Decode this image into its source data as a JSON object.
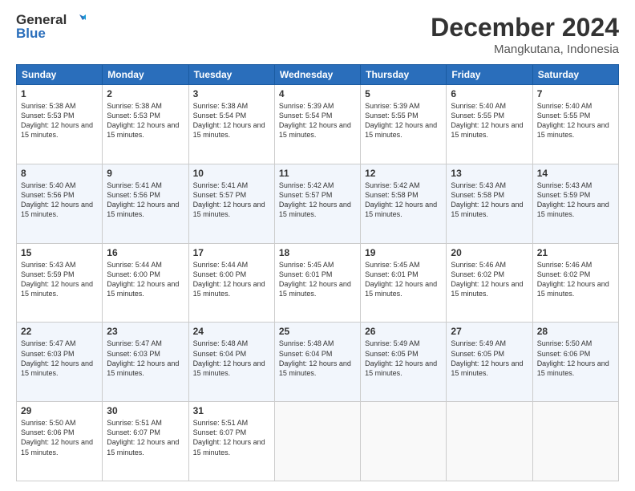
{
  "logo": {
    "line1": "General",
    "line2": "Blue"
  },
  "title": "December 2024",
  "subtitle": "Mangkutana, Indonesia",
  "days_of_week": [
    "Sunday",
    "Monday",
    "Tuesday",
    "Wednesday",
    "Thursday",
    "Friday",
    "Saturday"
  ],
  "weeks": [
    [
      {
        "day": "1",
        "info": "Sunrise: 5:38 AM\nSunset: 5:53 PM\nDaylight: 12 hours and 15 minutes."
      },
      {
        "day": "2",
        "info": "Sunrise: 5:38 AM\nSunset: 5:53 PM\nDaylight: 12 hours and 15 minutes."
      },
      {
        "day": "3",
        "info": "Sunrise: 5:38 AM\nSunset: 5:54 PM\nDaylight: 12 hours and 15 minutes."
      },
      {
        "day": "4",
        "info": "Sunrise: 5:39 AM\nSunset: 5:54 PM\nDaylight: 12 hours and 15 minutes."
      },
      {
        "day": "5",
        "info": "Sunrise: 5:39 AM\nSunset: 5:55 PM\nDaylight: 12 hours and 15 minutes."
      },
      {
        "day": "6",
        "info": "Sunrise: 5:40 AM\nSunset: 5:55 PM\nDaylight: 12 hours and 15 minutes."
      },
      {
        "day": "7",
        "info": "Sunrise: 5:40 AM\nSunset: 5:55 PM\nDaylight: 12 hours and 15 minutes."
      }
    ],
    [
      {
        "day": "8",
        "info": "Sunrise: 5:40 AM\nSunset: 5:56 PM\nDaylight: 12 hours and 15 minutes."
      },
      {
        "day": "9",
        "info": "Sunrise: 5:41 AM\nSunset: 5:56 PM\nDaylight: 12 hours and 15 minutes."
      },
      {
        "day": "10",
        "info": "Sunrise: 5:41 AM\nSunset: 5:57 PM\nDaylight: 12 hours and 15 minutes."
      },
      {
        "day": "11",
        "info": "Sunrise: 5:42 AM\nSunset: 5:57 PM\nDaylight: 12 hours and 15 minutes."
      },
      {
        "day": "12",
        "info": "Sunrise: 5:42 AM\nSunset: 5:58 PM\nDaylight: 12 hours and 15 minutes."
      },
      {
        "day": "13",
        "info": "Sunrise: 5:43 AM\nSunset: 5:58 PM\nDaylight: 12 hours and 15 minutes."
      },
      {
        "day": "14",
        "info": "Sunrise: 5:43 AM\nSunset: 5:59 PM\nDaylight: 12 hours and 15 minutes."
      }
    ],
    [
      {
        "day": "15",
        "info": "Sunrise: 5:43 AM\nSunset: 5:59 PM\nDaylight: 12 hours and 15 minutes."
      },
      {
        "day": "16",
        "info": "Sunrise: 5:44 AM\nSunset: 6:00 PM\nDaylight: 12 hours and 15 minutes."
      },
      {
        "day": "17",
        "info": "Sunrise: 5:44 AM\nSunset: 6:00 PM\nDaylight: 12 hours and 15 minutes."
      },
      {
        "day": "18",
        "info": "Sunrise: 5:45 AM\nSunset: 6:01 PM\nDaylight: 12 hours and 15 minutes."
      },
      {
        "day": "19",
        "info": "Sunrise: 5:45 AM\nSunset: 6:01 PM\nDaylight: 12 hours and 15 minutes."
      },
      {
        "day": "20",
        "info": "Sunrise: 5:46 AM\nSunset: 6:02 PM\nDaylight: 12 hours and 15 minutes."
      },
      {
        "day": "21",
        "info": "Sunrise: 5:46 AM\nSunset: 6:02 PM\nDaylight: 12 hours and 15 minutes."
      }
    ],
    [
      {
        "day": "22",
        "info": "Sunrise: 5:47 AM\nSunset: 6:03 PM\nDaylight: 12 hours and 15 minutes."
      },
      {
        "day": "23",
        "info": "Sunrise: 5:47 AM\nSunset: 6:03 PM\nDaylight: 12 hours and 15 minutes."
      },
      {
        "day": "24",
        "info": "Sunrise: 5:48 AM\nSunset: 6:04 PM\nDaylight: 12 hours and 15 minutes."
      },
      {
        "day": "25",
        "info": "Sunrise: 5:48 AM\nSunset: 6:04 PM\nDaylight: 12 hours and 15 minutes."
      },
      {
        "day": "26",
        "info": "Sunrise: 5:49 AM\nSunset: 6:05 PM\nDaylight: 12 hours and 15 minutes."
      },
      {
        "day": "27",
        "info": "Sunrise: 5:49 AM\nSunset: 6:05 PM\nDaylight: 12 hours and 15 minutes."
      },
      {
        "day": "28",
        "info": "Sunrise: 5:50 AM\nSunset: 6:06 PM\nDaylight: 12 hours and 15 minutes."
      }
    ],
    [
      {
        "day": "29",
        "info": "Sunrise: 5:50 AM\nSunset: 6:06 PM\nDaylight: 12 hours and 15 minutes."
      },
      {
        "day": "30",
        "info": "Sunrise: 5:51 AM\nSunset: 6:07 PM\nDaylight: 12 hours and 15 minutes."
      },
      {
        "day": "31",
        "info": "Sunrise: 5:51 AM\nSunset: 6:07 PM\nDaylight: 12 hours and 15 minutes."
      },
      {
        "day": "",
        "info": ""
      },
      {
        "day": "",
        "info": ""
      },
      {
        "day": "",
        "info": ""
      },
      {
        "day": "",
        "info": ""
      }
    ]
  ]
}
